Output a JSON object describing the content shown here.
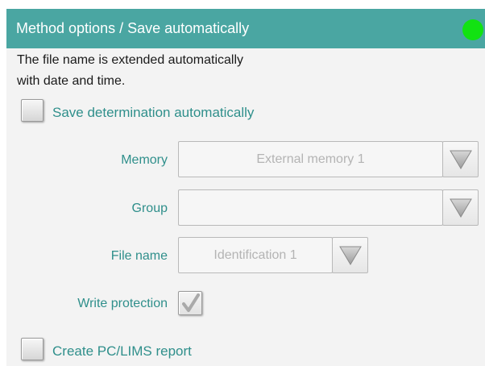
{
  "title": "Method options / Save automatically",
  "info_text": {
    "line1": "The file name is extended automatically",
    "line2": "with date and time."
  },
  "save_determination": {
    "label": "Save determination automatically",
    "checked": false
  },
  "memory": {
    "label": "Memory",
    "value": "External memory 1"
  },
  "group": {
    "label": "Group",
    "value": ""
  },
  "file_name": {
    "label": "File name",
    "value": "Identification 1"
  },
  "write_protection": {
    "label": "Write protection",
    "checked": true
  },
  "create_report": {
    "label": "Create PC/LIMS report",
    "checked": false
  },
  "colors": {
    "title_bar": "#4aa6a2",
    "status_led": "#12e212",
    "label_teal": "#2f8f8b"
  }
}
